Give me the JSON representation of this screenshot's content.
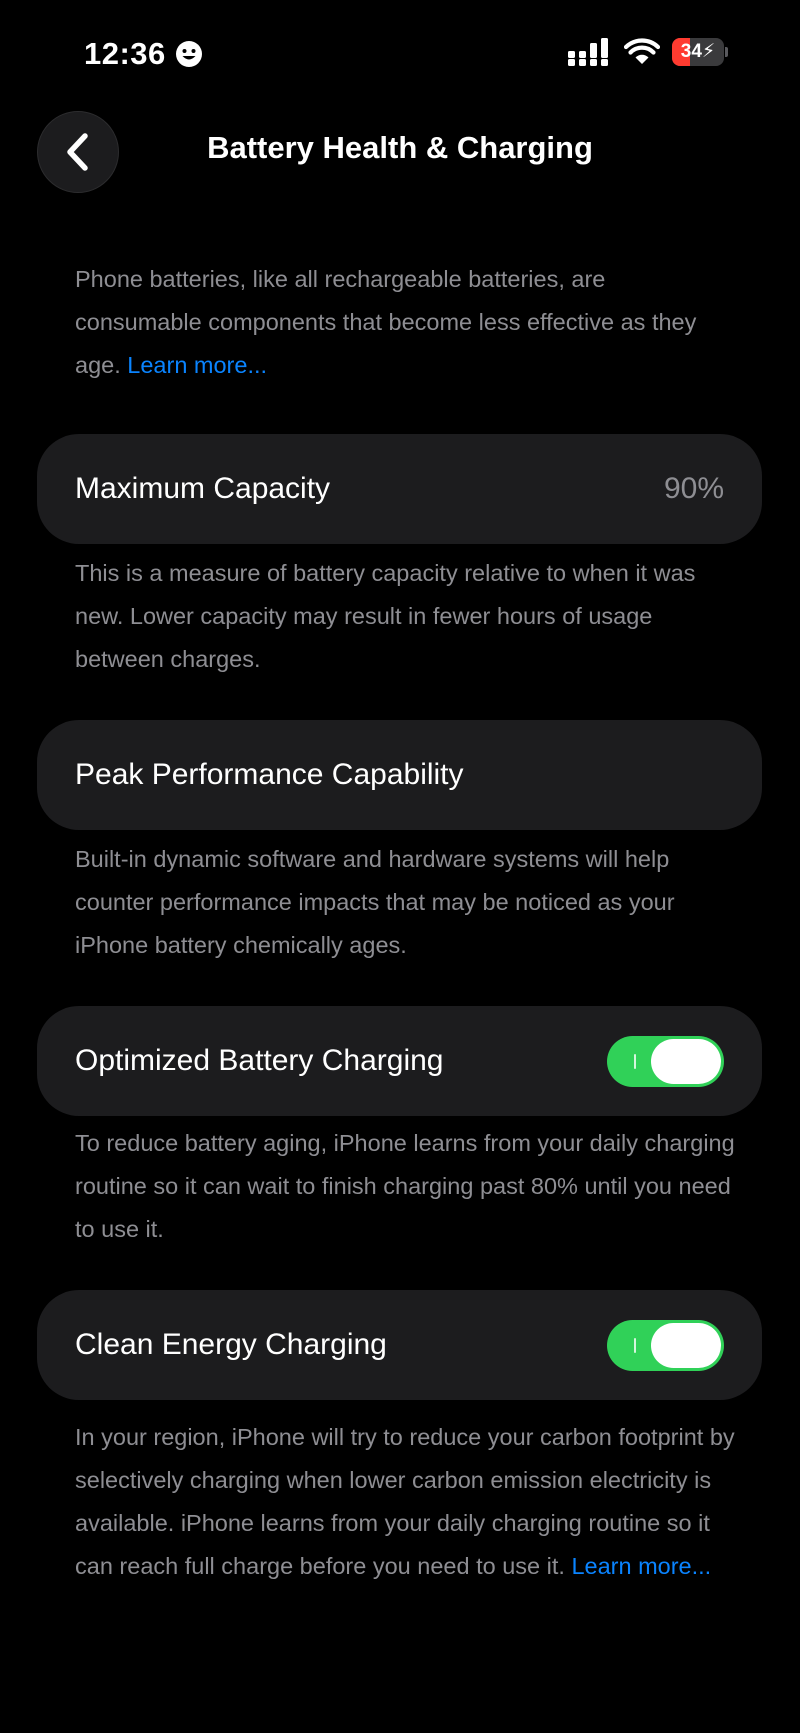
{
  "status_bar": {
    "time": "12:36",
    "battery_level": "34",
    "battery_fraction": 0.34,
    "focus_icon": "smiley-face-icon",
    "signal_icon": "cellular-signal-icon",
    "wifi_icon": "wifi-icon",
    "battery_icon": "battery-charging-icon"
  },
  "nav": {
    "back_icon": "chevron-left-icon",
    "title": "Battery Health & Charging"
  },
  "intro": {
    "text": "Phone batteries, like all rechargeable batteries, are consumable components that become less effective as they age.",
    "link": "Learn more..."
  },
  "maximum_capacity": {
    "label": "Maximum Capacity",
    "value": "90%",
    "footer": "This is a measure of battery capacity relative to when it was new. Lower capacity may result in fewer hours of usage between charges."
  },
  "peak_performance": {
    "label": "Peak Performance Capability",
    "footer": "Built-in dynamic software and hardware systems will help counter performance impacts that may be noticed as your iPhone battery chemically ages."
  },
  "optimized_charging": {
    "label": "Optimized Battery Charging",
    "enabled": true,
    "footer": "To reduce battery aging, iPhone learns from your daily charging routine so it can wait to finish charging past 80% until you need to use it."
  },
  "clean_energy": {
    "label": "Clean Energy Charging",
    "enabled": true,
    "footer": "In your region, iPhone will try to reduce your carbon footprint by selectively charging when lower carbon emission electricity is available. iPhone learns from your daily charging routine so it can reach full charge before you need to use it.",
    "link": "Learn more..."
  },
  "colors": {
    "background": "#000000",
    "cell": "#1c1c1e",
    "secondary_text": "#8e8e93",
    "link": "#0a84ff",
    "toggle_on": "#30d158",
    "battery_low": "#ff3b30"
  }
}
